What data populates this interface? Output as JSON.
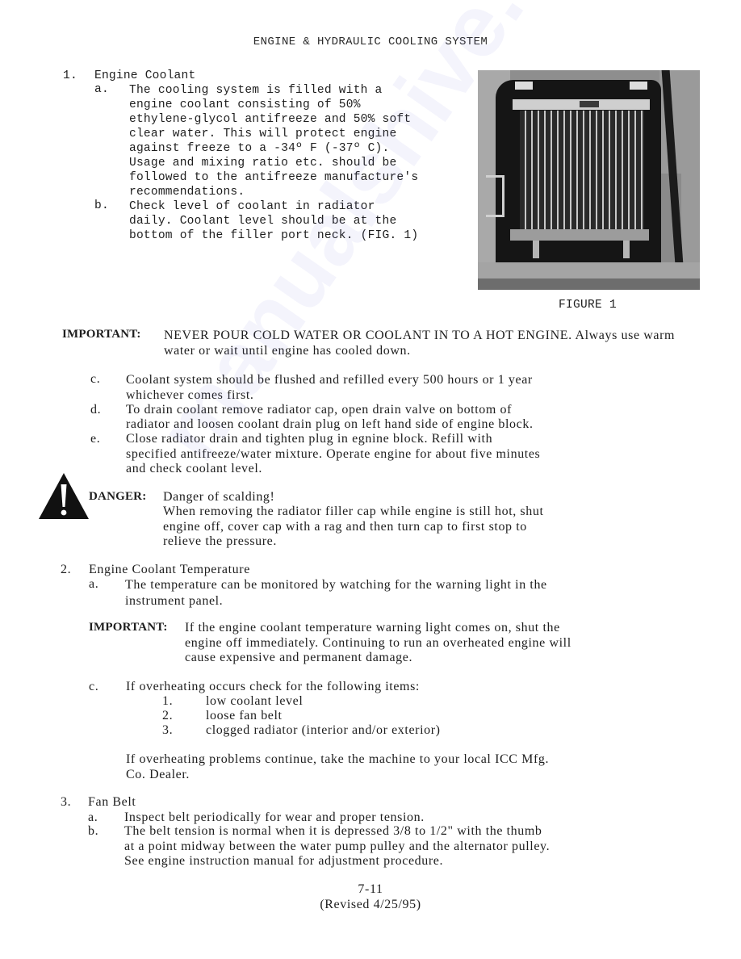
{
  "header": {
    "title": "ENGINE & HYDRAULIC COOLING SYSTEM"
  },
  "section1": {
    "number": "1.",
    "title": "Engine Coolant",
    "item_a": {
      "label": "a.",
      "lines": [
        "The cooling system is filled with a",
        "engine coolant consisting of 50%",
        "ethylene-glycol antifreeze and 50% soft",
        "clear water. This will protect engine",
        "against freeze to a -34º F (-37º C).",
        "Usage and mixing ratio etc. should be",
        "followed to the antifreeze manufacture's",
        "recommendations."
      ]
    },
    "item_b": {
      "label": "b.",
      "lines": [
        "Check level of coolant in radiator",
        "daily. Coolant level should be at the",
        "bottom of the filler port neck. (FIG. 1)"
      ]
    },
    "figure": {
      "caption": "FIGURE 1",
      "alt": "radiator-photo"
    },
    "important": {
      "label": "IMPORTANT:",
      "lines": [
        "NEVER POUR COLD WATER OR COOLANT IN TO A HOT ENGINE. Always use warm",
        "water or wait until engine has cooled down."
      ]
    },
    "item_c": {
      "label": "c.",
      "lines": [
        "Coolant system should be flushed and refilled every 500 hours or 1 year",
        "whichever comes first."
      ]
    },
    "item_d": {
      "label": "d.",
      "lines": [
        "To drain coolant remove radiator cap, open drain valve on bottom of",
        "radiator and loosen coolant drain plug on left hand side of engine block."
      ]
    },
    "item_e": {
      "label": "e.",
      "lines": [
        "Close radiator drain and tighten plug in egnine block. Refill with",
        "specified antifreeze/water mixture. Operate engine for about five minutes",
        "and check coolant level."
      ]
    },
    "danger": {
      "label": "DANGER:",
      "lines": [
        "Danger of scalding!",
        "When removing the radiator filler cap while engine is still hot, shut",
        "engine off, cover cap with a rag and then turn cap to first stop to",
        "relieve the pressure."
      ]
    }
  },
  "section2": {
    "number": "2.",
    "title": "Engine Coolant Temperature",
    "item_a": {
      "label": "a.",
      "lines": [
        "The temperature can be monitored by watching for the warning light in the",
        "instrument panel."
      ]
    },
    "important": {
      "label": "IMPORTANT:",
      "lines": [
        "If the engine coolant temperature warning light comes on, shut the",
        "engine off immediately. Continuing to run an overheated engine will",
        "cause expensive and permanent damage."
      ]
    },
    "item_c": {
      "label": "c.",
      "text": "If overheating occurs check for the following items:",
      "subitems": [
        {
          "label": "1.",
          "text": "low coolant level"
        },
        {
          "label": "2.",
          "text": "loose fan belt"
        },
        {
          "label": "3.",
          "text": "clogged radiator (interior and/or exterior)"
        }
      ]
    },
    "note": {
      "lines": [
        "If overheating problems continue, take the machine to your local ICC Mfg.",
        "Co. Dealer."
      ]
    }
  },
  "section3": {
    "number": "3.",
    "title": "Fan Belt",
    "item_a": {
      "label": "a.",
      "lines": [
        "Inspect belt periodically for wear and proper tension."
      ]
    },
    "item_b": {
      "label": "b.",
      "lines": [
        "The belt tension is normal when it is depressed 3/8 to 1/2\" with the thumb",
        "at a point midway between the water pump pulley and the alternator pulley.",
        "See engine instruction manual for adjustment procedure."
      ]
    }
  },
  "footer": {
    "page_number": "7-11",
    "revision": "(Revised 4/25/95)"
  },
  "watermark": {
    "text": "manualshive.com"
  }
}
